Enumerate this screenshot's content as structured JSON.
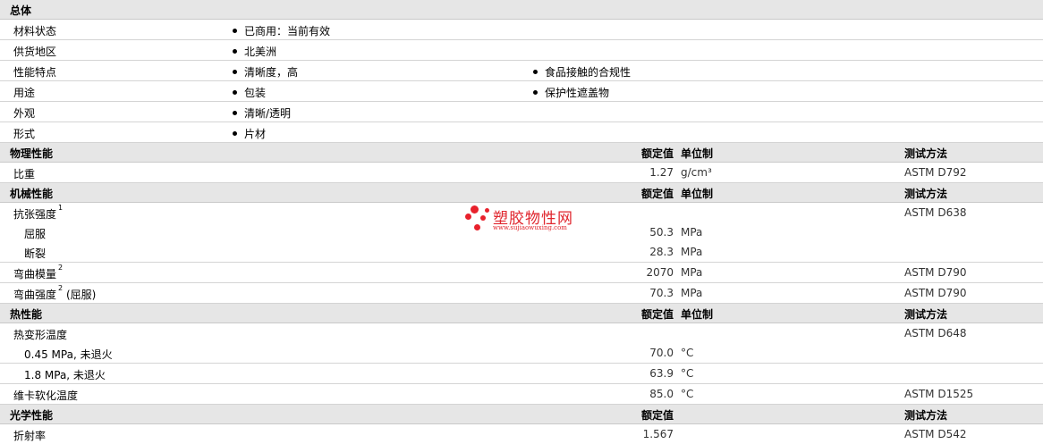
{
  "general": {
    "title": "总体",
    "rows": [
      {
        "label": "材料状态",
        "items": [
          "已商用：当前有效"
        ]
      },
      {
        "label": "供货地区",
        "items": [
          "北美洲"
        ]
      },
      {
        "label": "性能特点",
        "items": [
          "清晰度，高",
          "食品接触的合规性"
        ]
      },
      {
        "label": "用途",
        "items": [
          "包装",
          "保护性遮盖物"
        ]
      },
      {
        "label": "外观",
        "items": [
          "清晰/透明"
        ]
      },
      {
        "label": "形式",
        "items": [
          "片材"
        ]
      }
    ]
  },
  "physical": {
    "title": "物理性能",
    "col_nominal": "额定值",
    "col_unit": "单位制",
    "col_method": "测试方法",
    "rows": [
      {
        "label": "比重",
        "value": "1.27",
        "unit": "g/cm³",
        "method": "ASTM D792"
      }
    ]
  },
  "mechanical": {
    "title": "机械性能",
    "col_nominal": "额定值",
    "col_unit": "单位制",
    "col_method": "测试方法",
    "rows": [
      {
        "label": "抗张强度",
        "sup": "1",
        "value": "",
        "unit": "",
        "method": "ASTM D638"
      },
      {
        "label": "屈服",
        "value": "50.3",
        "unit": "MPa",
        "method": ""
      },
      {
        "label": "断裂",
        "value": "28.3",
        "unit": "MPa",
        "method": ""
      },
      {
        "label": "弯曲模量",
        "sup": "2",
        "value": "2070",
        "unit": "MPa",
        "method": "ASTM D790"
      },
      {
        "label": "弯曲强度",
        "sup": "2",
        "suffix": "(屈服)",
        "value": "70.3",
        "unit": "MPa",
        "method": "ASTM D790"
      }
    ]
  },
  "thermal": {
    "title": "热性能",
    "col_nominal": "额定值",
    "col_unit": "单位制",
    "col_method": "测试方法",
    "rows": [
      {
        "label": "热变形温度",
        "value": "",
        "unit": "",
        "method": "ASTM D648"
      },
      {
        "label": "0.45 MPa, 未退火",
        "value": "70.0",
        "unit": "°C",
        "method": ""
      },
      {
        "label": "1.8 MPa, 未退火",
        "value": "63.9",
        "unit": "°C",
        "method": ""
      },
      {
        "label": "维卡软化温度",
        "value": "85.0",
        "unit": "°C",
        "method": "ASTM D1525"
      }
    ]
  },
  "optical": {
    "title": "光学性能",
    "col_nominal": "额定值",
    "col_method": "测试方法",
    "rows": [
      {
        "label": "折射率",
        "value": "1.567",
        "method": "ASTM D542"
      }
    ]
  },
  "watermark": {
    "name": "塑胶物性网",
    "url": "www.sujiaowuxing.com",
    "color": "#e8212c"
  }
}
